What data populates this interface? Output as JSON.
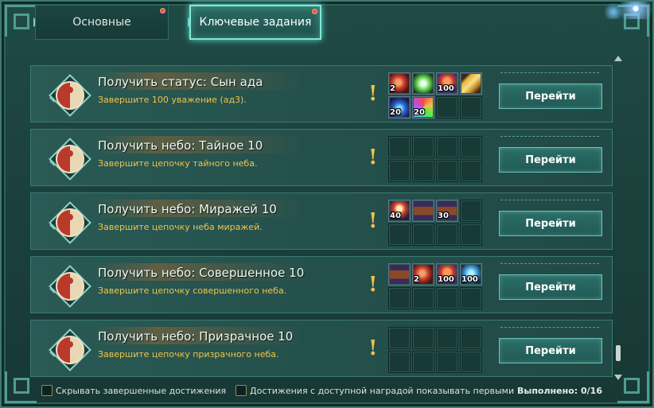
{
  "tabs": [
    {
      "label": "Основные",
      "has_alert": true
    },
    {
      "label": "Ключевые задания",
      "has_alert": true,
      "active": true
    }
  ],
  "tasks": [
    {
      "title": "Получить статус: Сын ада",
      "description": "Завершите 100 уважение (ад3).",
      "go_label": "Перейти",
      "rewards": [
        {
          "icon": "red-potion-icon",
          "count": "2"
        },
        {
          "icon": "green-orb-icon",
          "count": ""
        },
        {
          "icon": "fire-bundle-icon",
          "count": "100"
        },
        {
          "icon": "gold-ingot-icon",
          "count": ""
        },
        {
          "icon": "blue-gem-icon",
          "count": "20"
        },
        {
          "icon": "rainbow-gem-icon",
          "count": "20"
        }
      ]
    },
    {
      "title": "Получить небо: Тайное 10",
      "description": "Завершите цепочку тайного неба.",
      "go_label": "Перейти",
      "rewards": []
    },
    {
      "title": "Получить небо: Миражей 10",
      "description": "Завершите цепочку неба миражей.",
      "go_label": "Перейти",
      "rewards": [
        {
          "icon": "scroll-icon",
          "count": "40"
        },
        {
          "icon": "chest-icon",
          "count": ""
        },
        {
          "icon": "chest-icon",
          "count": "30"
        }
      ]
    },
    {
      "title": "Получить небо: Совершенное 10",
      "description": "Завершите цепочку совершенного неба.",
      "go_label": "Перейти",
      "rewards": [
        {
          "icon": "chest-icon",
          "count": ""
        },
        {
          "icon": "red-potion-icon",
          "count": "2"
        },
        {
          "icon": "fire-bundle-icon",
          "count": "100"
        },
        {
          "icon": "blue-orb-icon",
          "count": "100"
        }
      ]
    },
    {
      "title": "Получить небо: Призрачное 10",
      "description": "Завершите цепочку призрачного неба.",
      "go_label": "Перейти",
      "rewards": []
    }
  ],
  "footer": {
    "hide_completed_label": "Скрывать завершенные достижения",
    "show_available_first_label": "Достижения с доступной наградой показывать первыми",
    "completed_label": "Выполнено: 0/16"
  },
  "colors": {
    "accent": "#7fe9d9",
    "description": "#f0c34a",
    "alert_dot": "#e05a4c"
  }
}
